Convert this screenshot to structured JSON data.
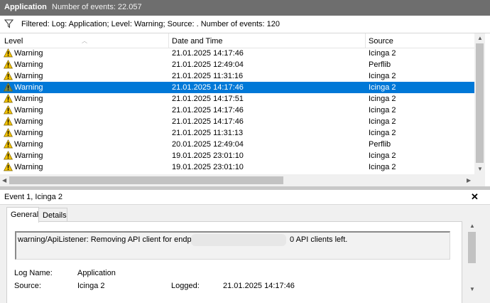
{
  "header": {
    "app_title": "Application",
    "event_count": "Number of events: 22.057"
  },
  "filter": {
    "text": "Filtered: Log: Application; Level: Warning; Source: . Number of events: 120"
  },
  "table": {
    "columns": [
      "Level",
      "Date and Time",
      "Source"
    ],
    "rows": [
      {
        "level": "Warning",
        "datetime": "21.01.2025 14:17:46",
        "source": "Icinga 2"
      },
      {
        "level": "Warning",
        "datetime": "21.01.2025 12:49:04",
        "source": "Perflib"
      },
      {
        "level": "Warning",
        "datetime": "21.01.2025 11:31:16",
        "source": "Icinga 2"
      },
      {
        "level": "Warning",
        "datetime": "21.01.2025 14:17:46",
        "source": "Icinga 2"
      },
      {
        "level": "Warning",
        "datetime": "21.01.2025 14:17:51",
        "source": "Icinga 2"
      },
      {
        "level": "Warning",
        "datetime": "21.01.2025 14:17:46",
        "source": "Icinga 2"
      },
      {
        "level": "Warning",
        "datetime": "21.01.2025 14:17:46",
        "source": "Icinga 2"
      },
      {
        "level": "Warning",
        "datetime": "21.01.2025 11:31:13",
        "source": "Icinga 2"
      },
      {
        "level": "Warning",
        "datetime": "20.01.2025 12:49:04",
        "source": "Perflib"
      },
      {
        "level": "Warning",
        "datetime": "19.01.2025 23:01:10",
        "source": "Icinga 2"
      },
      {
        "level": "Warning",
        "datetime": "19.01.2025 23:01:10",
        "source": "Icinga 2"
      }
    ],
    "selected_index": 3
  },
  "details": {
    "title": "Event 1, Icinga 2",
    "tabs": [
      "General",
      "Details"
    ],
    "message_start": "warning/ApiListener: Removing API client for endpoint",
    "message_end": "0 API clients left.",
    "log_name_label": "Log Name:",
    "log_name_value": "Application",
    "source_label": "Source:",
    "source_value": "Icinga 2",
    "logged_label": "Logged:",
    "logged_value": "21.01.2025 14:17:46"
  },
  "colors": {
    "selection": "#0078d7",
    "titlebar": "#6e6e6e",
    "warning": "#f2c200"
  }
}
